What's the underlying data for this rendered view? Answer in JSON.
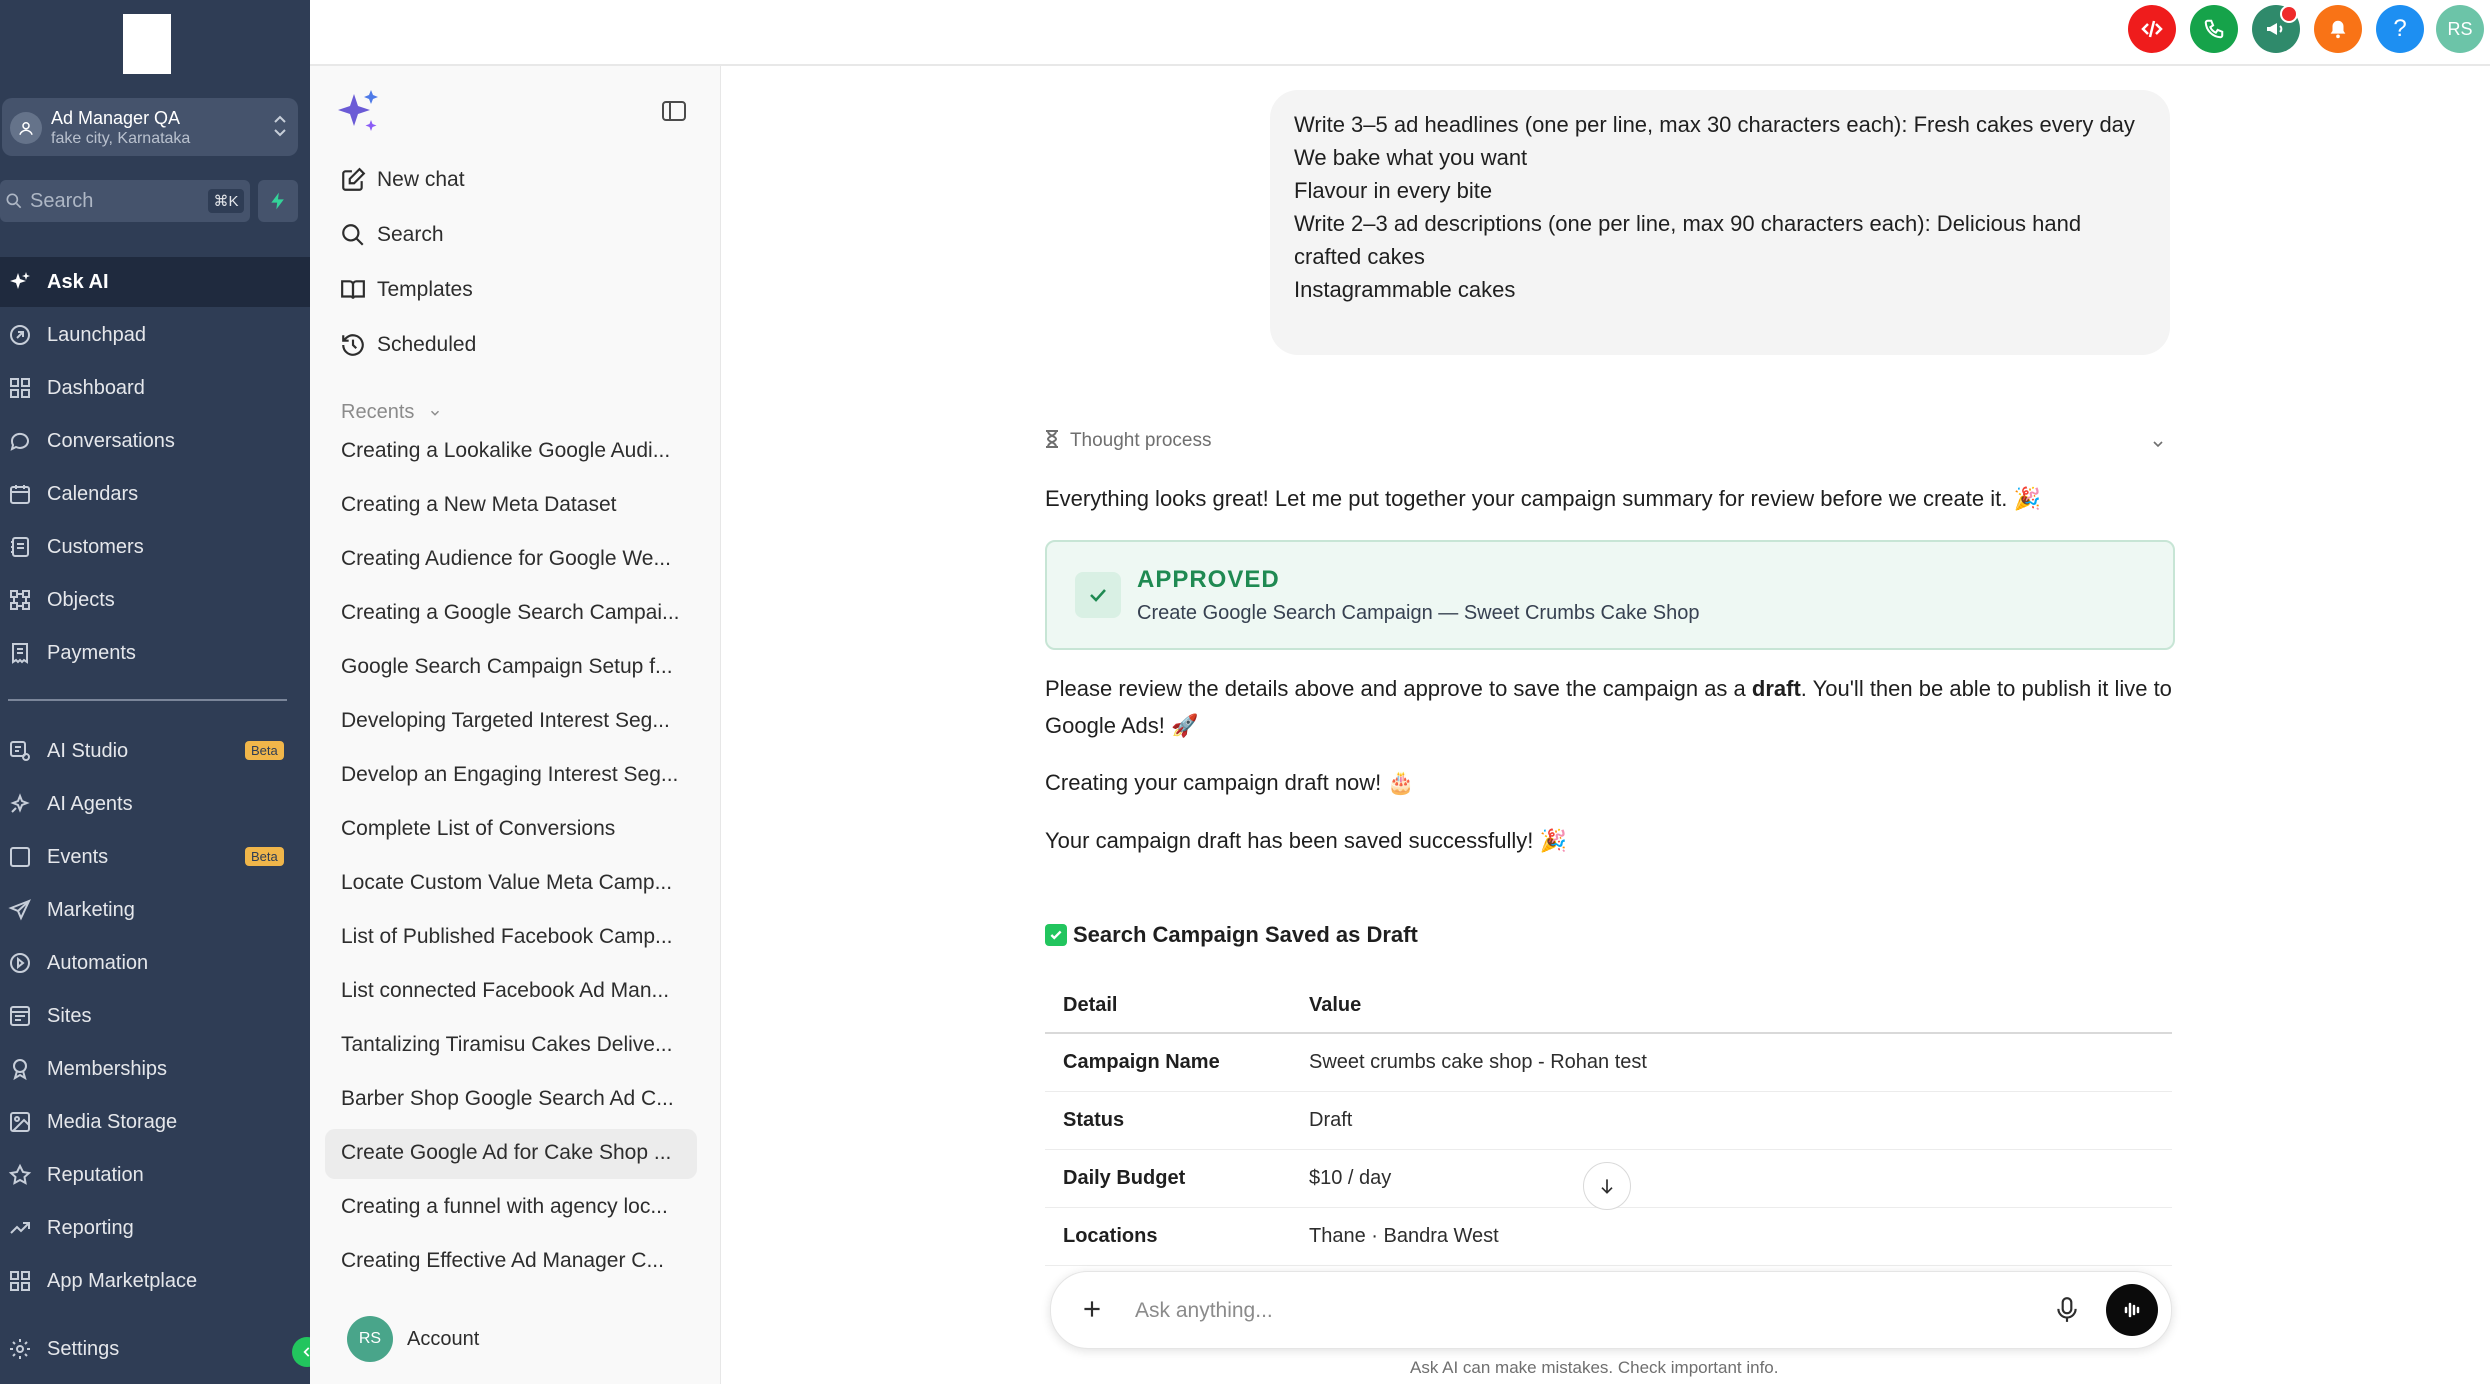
{
  "nav": {
    "account_name": "Ad Manager QA",
    "account_location": "fake city, Karnataka",
    "search_placeholder": "Search",
    "search_shortcut": "⌘K",
    "items": [
      {
        "label": "Ask AI",
        "icon": "sparkle-icon",
        "active": true
      },
      {
        "label": "Launchpad",
        "icon": "rocket-icon"
      },
      {
        "label": "Dashboard",
        "icon": "dashboard-icon"
      },
      {
        "label": "Conversations",
        "icon": "chat-bubble-icon"
      },
      {
        "label": "Calendars",
        "icon": "calendar-icon"
      },
      {
        "label": "Customers",
        "icon": "contacts-icon"
      },
      {
        "label": "Objects",
        "icon": "objects-icon"
      },
      {
        "label": "Payments",
        "icon": "receipt-icon"
      },
      {
        "label": "AI Studio",
        "icon": "ai-studio-icon",
        "badge": "Beta"
      },
      {
        "label": "AI Agents",
        "icon": "ai-agents-icon"
      },
      {
        "label": "Events",
        "icon": "events-icon",
        "badge": "Beta"
      },
      {
        "label": "Marketing",
        "icon": "send-icon"
      },
      {
        "label": "Automation",
        "icon": "automation-icon"
      },
      {
        "label": "Sites",
        "icon": "sites-icon"
      },
      {
        "label": "Memberships",
        "icon": "badge-icon"
      },
      {
        "label": "Media Storage",
        "icon": "image-icon"
      },
      {
        "label": "Reputation",
        "icon": "star-icon"
      },
      {
        "label": "Reporting",
        "icon": "trend-icon"
      },
      {
        "label": "App Marketplace",
        "icon": "grid-plus-icon"
      },
      {
        "label": "Settings",
        "icon": "gear-icon"
      }
    ]
  },
  "chat_sidebar": {
    "actions": [
      {
        "label": "New chat",
        "icon": "edit-icon"
      },
      {
        "label": "Search",
        "icon": "search-icon"
      },
      {
        "label": "Templates",
        "icon": "book-icon"
      },
      {
        "label": "Scheduled",
        "icon": "history-icon"
      }
    ],
    "recents_label": "Recents",
    "recents": [
      "Creating a Lookalike Google Audi...",
      "Creating a New Meta Dataset",
      "Creating Audience for Google We...",
      "Creating a Google Search Campai...",
      "Google Search Campaign Setup f...",
      "Developing Targeted Interest Seg...",
      "Develop an Engaging Interest Seg...",
      "Complete List of Conversions",
      "Locate Custom Value Meta Camp...",
      "List of Published Facebook Camp...",
      "List connected Facebook Ad Man...",
      "Tantalizing Tiramisu Cakes Delive...",
      "Barber Shop Google Search Ad C...",
      "Create Google Ad for Cake Shop ...",
      "Creating a funnel with agency loc...",
      "Creating Effective Ad Manager C..."
    ],
    "selected_recent_index": 13,
    "account_initials": "RS",
    "account_label": "Account"
  },
  "topbar": {
    "buttons": [
      {
        "icon": "code-icon",
        "color": "#ef1c1c"
      },
      {
        "icon": "phone-icon",
        "color": "#16a34a"
      },
      {
        "icon": "megaphone-icon",
        "color": "#2f8a6b"
      },
      {
        "icon": "bell-icon",
        "color": "#f97316"
      },
      {
        "icon": "help-icon",
        "color": "#1d8ff2"
      },
      {
        "icon": "user-avatar",
        "color": "#6cc4a8"
      }
    ],
    "help_glyph": "?",
    "user_initials": "RS"
  },
  "chat": {
    "user_message": "Write 3–5 ad headlines (one per line, max 30 characters each): Fresh cakes every day\nWe bake what you want\nFlavour in every bite\nWrite 2–3 ad descriptions (one per line, max 90 characters each): Delicious hand crafted cakes\nInstagrammable cakes",
    "thought_label": "Thought process",
    "intro": "Everything looks great! Let me put together your campaign summary for review before we create it. 🎉",
    "approved_title": "APPROVED",
    "approved_subtitle": "Create Google Search Campaign — Sweet Crumbs Cake Shop",
    "review_pre": "Please review the details above and approve to save the campaign as a ",
    "review_bold": "draft",
    "review_post": ". You'll then be able to publish it live to Google Ads! 🚀",
    "creating": "Creating your campaign draft now! 🎂",
    "saved": "Your campaign draft has been saved successfully! 🎉",
    "section_title": "Search Campaign Saved as Draft",
    "table_headers": [
      "Detail",
      "Value"
    ],
    "table_rows": [
      [
        "Campaign Name",
        "Sweet crumbs cake shop - Rohan test"
      ],
      [
        "Status",
        "Draft"
      ],
      [
        "Daily Budget",
        "$10 / day"
      ],
      [
        "Locations",
        "Thane · Bandra West"
      ]
    ],
    "composer_placeholder": "Ask anything...",
    "disclaimer": "Ask AI can make mistakes. Check important info."
  }
}
